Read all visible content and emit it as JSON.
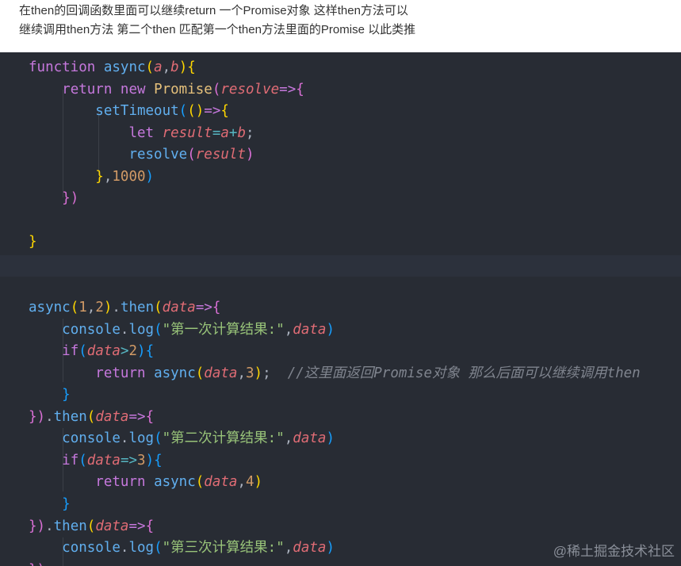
{
  "intro": {
    "line1": "在then的回调函数里面可以继续return  一个Promise对象 这样then方法可以",
    "line2": "继续调用then方法  第二个then  匹配第一个then方法里面的Promise 以此类推"
  },
  "code": {
    "lines": [
      [
        [
          "kw",
          "function"
        ],
        [
          "pl",
          " "
        ],
        [
          "fn",
          "async"
        ],
        [
          "b1",
          "("
        ],
        [
          "param",
          "a"
        ],
        [
          "pl",
          ","
        ],
        [
          "param",
          "b"
        ],
        [
          "b1",
          ")"
        ],
        [
          "b1",
          "{"
        ]
      ],
      [
        [
          "pl",
          "    "
        ],
        [
          "kw",
          "return"
        ],
        [
          "pl",
          " "
        ],
        [
          "kw",
          "new"
        ],
        [
          "pl",
          " "
        ],
        [
          "cls",
          "Promise"
        ],
        [
          "b2",
          "("
        ],
        [
          "param",
          "resolve"
        ],
        [
          "kw",
          "=>"
        ],
        [
          "b2",
          "{"
        ]
      ],
      [
        [
          "pl",
          "        "
        ],
        [
          "fn",
          "setTimeout"
        ],
        [
          "b3",
          "("
        ],
        [
          "b1",
          "()"
        ],
        [
          "kw",
          "=>"
        ],
        [
          "b1",
          "{"
        ]
      ],
      [
        [
          "pl",
          "            "
        ],
        [
          "kw",
          "let"
        ],
        [
          "pl",
          " "
        ],
        [
          "param",
          "result"
        ],
        [
          "op",
          "="
        ],
        [
          "param",
          "a"
        ],
        [
          "op",
          "+"
        ],
        [
          "param",
          "b"
        ],
        [
          "pl",
          ";"
        ]
      ],
      [
        [
          "pl",
          "            "
        ],
        [
          "fn",
          "resolve"
        ],
        [
          "b2",
          "("
        ],
        [
          "param",
          "result"
        ],
        [
          "b2",
          ")"
        ]
      ],
      [
        [
          "pl",
          "        "
        ],
        [
          "b1",
          "}"
        ],
        [
          "pl",
          ","
        ],
        [
          "num",
          "1000"
        ],
        [
          "b3",
          ")"
        ]
      ],
      [
        [
          "pl",
          "    "
        ],
        [
          "b2",
          "})"
        ]
      ],
      [],
      [
        [
          "b1",
          "}"
        ]
      ],
      [],
      [],
      [
        [
          "fn",
          "async"
        ],
        [
          "b1",
          "("
        ],
        [
          "num",
          "1"
        ],
        [
          "pl",
          ","
        ],
        [
          "num",
          "2"
        ],
        [
          "b1",
          ")"
        ],
        [
          "pl",
          "."
        ],
        [
          "fn",
          "then"
        ],
        [
          "b1",
          "("
        ],
        [
          "param",
          "data"
        ],
        [
          "kw",
          "=>"
        ],
        [
          "b2",
          "{"
        ]
      ],
      [
        [
          "pl",
          "    "
        ],
        [
          "fn",
          "console"
        ],
        [
          "pl",
          "."
        ],
        [
          "fn",
          "log"
        ],
        [
          "b3",
          "("
        ],
        [
          "str",
          "\"第一次计算结果:\""
        ],
        [
          "pl",
          ","
        ],
        [
          "param",
          "data"
        ],
        [
          "b3",
          ")"
        ]
      ],
      [
        [
          "pl",
          "    "
        ],
        [
          "kw",
          "if"
        ],
        [
          "b3",
          "("
        ],
        [
          "param",
          "data"
        ],
        [
          "op",
          ">"
        ],
        [
          "num",
          "2"
        ],
        [
          "b3",
          ")"
        ],
        [
          "b3",
          "{"
        ]
      ],
      [
        [
          "pl",
          "        "
        ],
        [
          "kw",
          "return"
        ],
        [
          "pl",
          " "
        ],
        [
          "fn",
          "async"
        ],
        [
          "b1",
          "("
        ],
        [
          "param",
          "data"
        ],
        [
          "pl",
          ","
        ],
        [
          "num",
          "3"
        ],
        [
          "b1",
          ")"
        ],
        [
          "pl",
          ";  "
        ],
        [
          "cmt",
          "//这里面返回Promise对象 那么后面可以继续调用then"
        ]
      ],
      [
        [
          "pl",
          "    "
        ],
        [
          "b3",
          "}"
        ]
      ],
      [
        [
          "b2",
          "})"
        ],
        [
          "pl",
          "."
        ],
        [
          "fn",
          "then"
        ],
        [
          "b1",
          "("
        ],
        [
          "param",
          "data"
        ],
        [
          "kw",
          "=>"
        ],
        [
          "b2",
          "{"
        ]
      ],
      [
        [
          "pl",
          "    "
        ],
        [
          "fn",
          "console"
        ],
        [
          "pl",
          "."
        ],
        [
          "fn",
          "log"
        ],
        [
          "b3",
          "("
        ],
        [
          "str",
          "\"第二次计算结果:\""
        ],
        [
          "pl",
          ","
        ],
        [
          "param",
          "data"
        ],
        [
          "b3",
          ")"
        ]
      ],
      [
        [
          "pl",
          "    "
        ],
        [
          "kw",
          "if"
        ],
        [
          "b3",
          "("
        ],
        [
          "param",
          "data"
        ],
        [
          "op",
          "=>"
        ],
        [
          "num",
          "3"
        ],
        [
          "b3",
          ")"
        ],
        [
          "b3",
          "{"
        ]
      ],
      [
        [
          "pl",
          "        "
        ],
        [
          "kw",
          "return"
        ],
        [
          "pl",
          " "
        ],
        [
          "fn",
          "async"
        ],
        [
          "b1",
          "("
        ],
        [
          "param",
          "data"
        ],
        [
          "pl",
          ","
        ],
        [
          "num",
          "4"
        ],
        [
          "b1",
          ")"
        ]
      ],
      [
        [
          "pl",
          "    "
        ],
        [
          "b3",
          "}"
        ]
      ],
      [
        [
          "b2",
          "})"
        ],
        [
          "pl",
          "."
        ],
        [
          "fn",
          "then"
        ],
        [
          "b1",
          "("
        ],
        [
          "param",
          "data"
        ],
        [
          "kw",
          "=>"
        ],
        [
          "b2",
          "{"
        ]
      ],
      [
        [
          "pl",
          "    "
        ],
        [
          "fn",
          "console"
        ],
        [
          "pl",
          "."
        ],
        [
          "fn",
          "log"
        ],
        [
          "b3",
          "("
        ],
        [
          "str",
          "\"第三次计算结果:\""
        ],
        [
          "pl",
          ","
        ],
        [
          "param",
          "data"
        ],
        [
          "b3",
          ")"
        ]
      ],
      [
        [
          "b2",
          "})"
        ]
      ]
    ]
  },
  "watermark": "@稀土掘金技术社区"
}
